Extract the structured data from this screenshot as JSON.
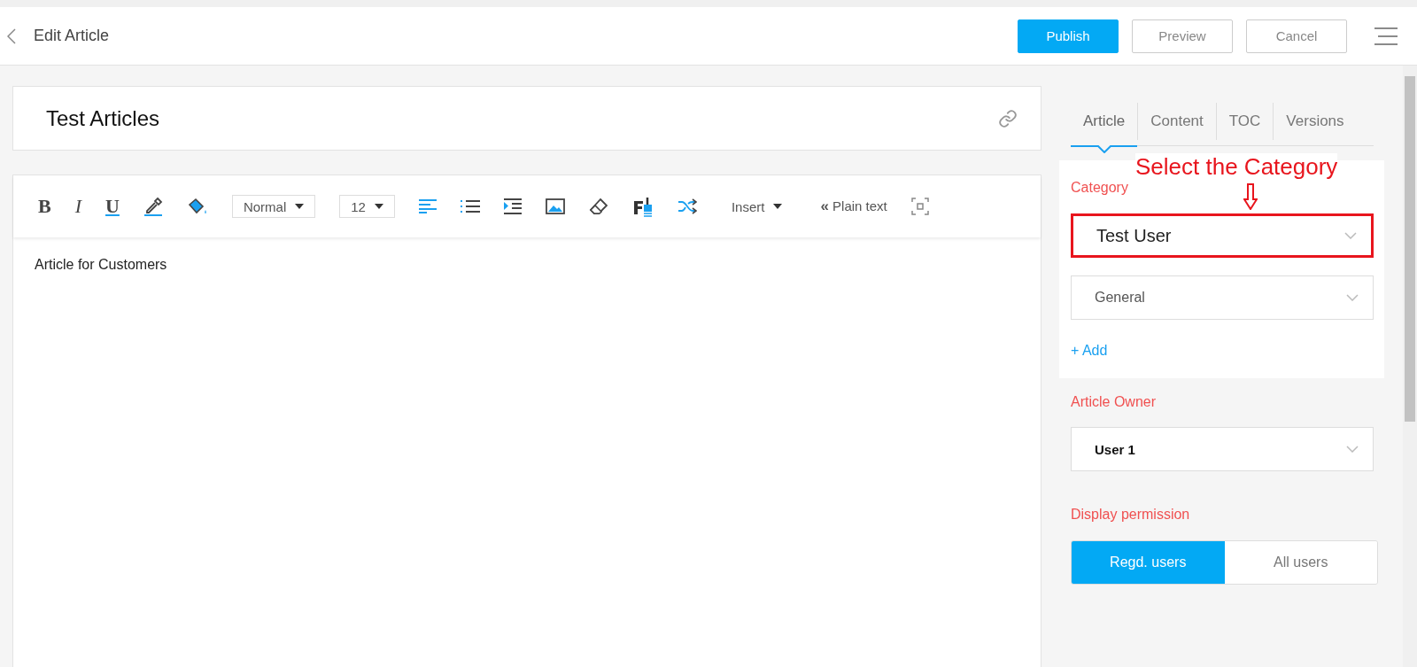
{
  "header": {
    "title": "Edit Article",
    "buttons": [
      {
        "label": "Publish",
        "primary": true
      },
      {
        "label": "Preview",
        "primary": false
      },
      {
        "label": "Cancel",
        "primary": false
      }
    ]
  },
  "article": {
    "title": "Test Articles",
    "body": "Article for Customers"
  },
  "toolbar": {
    "bold": "B",
    "italic": "I",
    "underline": "U",
    "style_dropdown": "Normal",
    "size_dropdown": "12",
    "insert_dropdown": "Insert",
    "plain_text_icon": "«",
    "plain_text": "Plain text"
  },
  "tabs": [
    {
      "label": "Article",
      "selected": true
    },
    {
      "label": "Content",
      "selected": false
    },
    {
      "label": "TOC",
      "selected": false
    },
    {
      "label": "Versions",
      "selected": false
    }
  ],
  "category": {
    "label": "Category",
    "selects": [
      {
        "value": "Test User",
        "highlighted": true
      },
      {
        "value": "General",
        "highlighted": false
      }
    ],
    "add_link": "+ Add"
  },
  "annotation": {
    "text": "Select the Category"
  },
  "owner": {
    "label": "Article Owner",
    "value": "User 1"
  },
  "permission": {
    "label": "Display permission",
    "options": [
      {
        "label": "Regd. users",
        "selected": true
      },
      {
        "label": "All users",
        "selected": false
      }
    ]
  }
}
